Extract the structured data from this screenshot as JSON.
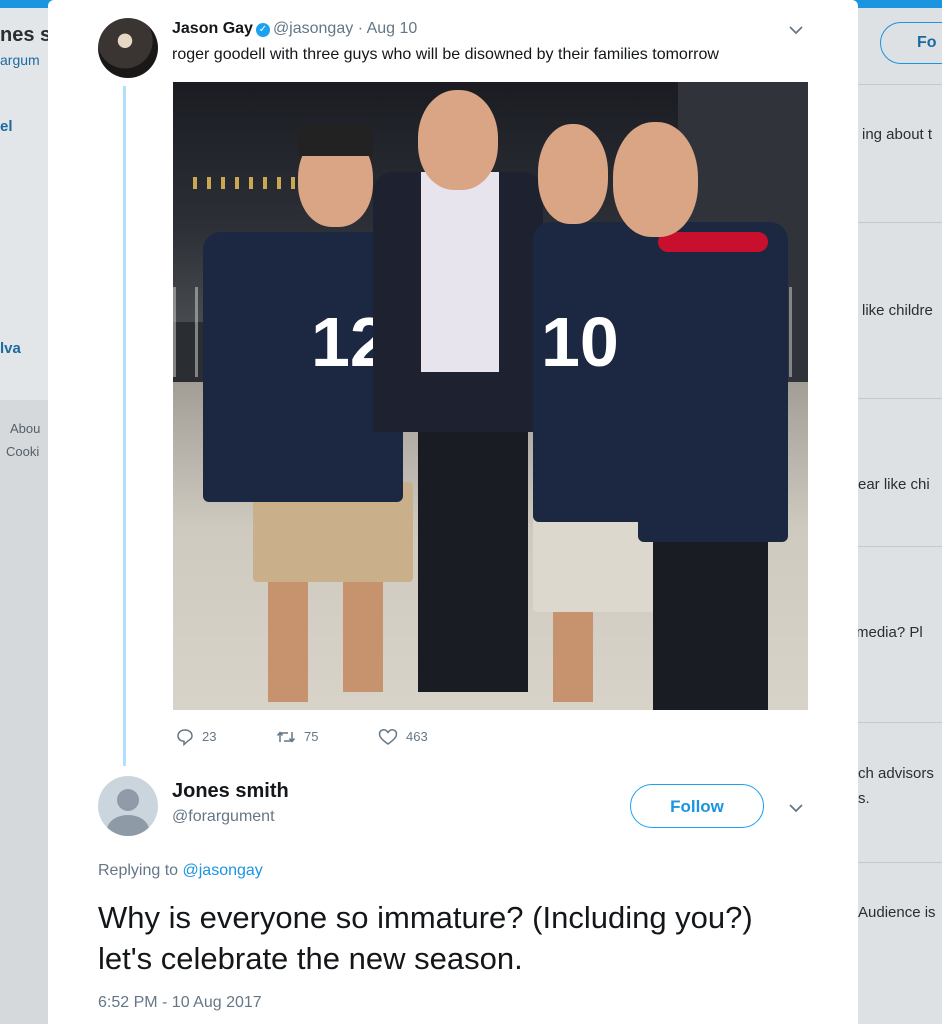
{
  "background": {
    "left_title": "nes s",
    "left_handle": "argum",
    "left_item_1": "el",
    "left_item_2": "lva",
    "left_footer_1": "Abou",
    "left_footer_2": "Cooki",
    "follow_label": "Fo",
    "right_snippets": [
      "ing about t",
      "like childre",
      "ear like chi",
      "media? Pl",
      "ch advisors",
      "s.",
      "Audience is"
    ]
  },
  "tweet": {
    "author_name": "Jason Gay",
    "verified": true,
    "handle": "@jasongay",
    "separator": "·",
    "date": "Aug 10",
    "text": "roger goodell with three guys who will be disowned by their families tomorrow",
    "photo": {
      "jersey_numbers": [
        "12",
        "10"
      ],
      "colors": {
        "jersey": "#1c2741",
        "shorts": "#c9b08a"
      }
    },
    "stats": {
      "replies": "23",
      "retweets": "75",
      "likes": "463"
    }
  },
  "reply": {
    "author_name": "Jones smith",
    "handle": "@forargument",
    "follow_label": "Follow",
    "replying_prefix": "Replying to",
    "replying_to": "@jasongay",
    "text": "Why is everyone so immature? (Including you?) let's celebrate the new season.",
    "timestamp": "6:52 PM - 10 Aug 2017"
  },
  "colors": {
    "accent": "#1da1f2",
    "link": "#1b95e0",
    "thread_line": "#b2dffb",
    "muted": "#657786"
  },
  "icons": [
    "reply-icon",
    "retweet-icon",
    "like-icon",
    "chevron-down-icon",
    "verified-badge-icon",
    "default-avatar-icon"
  ]
}
